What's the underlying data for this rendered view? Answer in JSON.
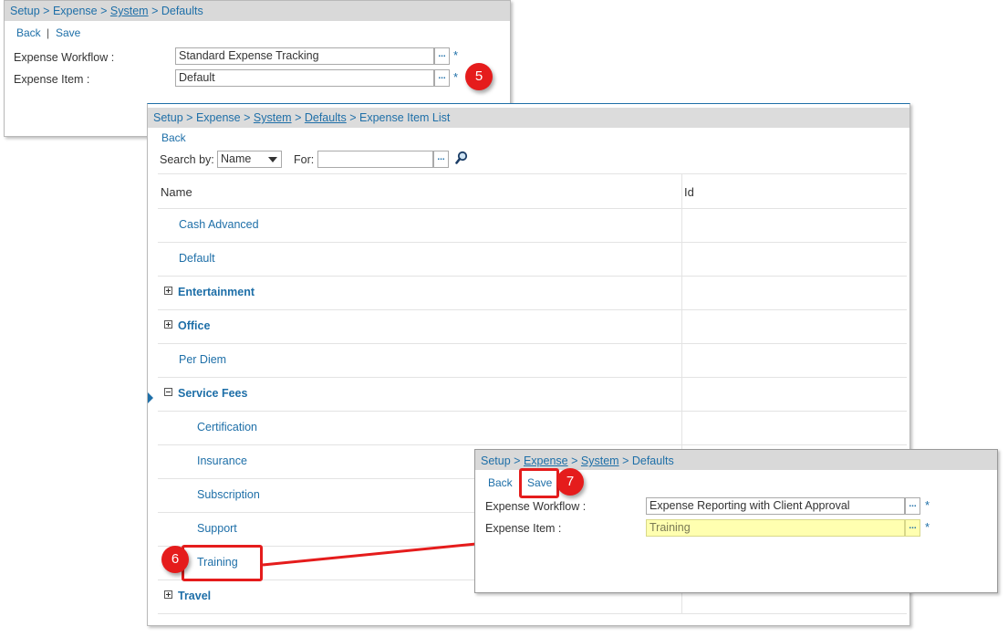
{
  "panel1": {
    "breadcrumb": [
      "Setup",
      "Expense",
      "System",
      "Defaults"
    ],
    "back": "Back",
    "save": "Save",
    "workflow_label": "Expense Workflow :",
    "workflow_value": "Standard Expense Tracking",
    "item_label": "Expense Item :",
    "item_value": "Default",
    "required": "*",
    "dots": "...",
    "callout": "5"
  },
  "panel2": {
    "breadcrumb": [
      "Setup",
      "Expense",
      "System",
      "Defaults",
      "Expense Item List"
    ],
    "back": "Back",
    "search_by_label": "Search by:",
    "search_by_value": "Name",
    "for_label": "For:",
    "dots": "...",
    "columns": [
      "Name",
      "Id"
    ],
    "rows": [
      {
        "name": "Cash Advanced",
        "group": false
      },
      {
        "name": "Default",
        "group": false
      },
      {
        "name": "Entertainment",
        "group": true,
        "expanded": false
      },
      {
        "name": "Office",
        "group": true,
        "expanded": false
      },
      {
        "name": "Per Diem",
        "group": false
      },
      {
        "name": "Service Fees",
        "group": true,
        "expanded": true
      },
      {
        "name": "Certification",
        "group": false,
        "child": true
      },
      {
        "name": "Insurance",
        "group": false,
        "child": true
      },
      {
        "name": "Subscription",
        "group": false,
        "child": true
      },
      {
        "name": "Support",
        "group": false,
        "child": true
      },
      {
        "name": "Training",
        "group": false,
        "child": true
      },
      {
        "name": "Travel",
        "group": true,
        "expanded": false
      }
    ],
    "callout": "6"
  },
  "panel3": {
    "breadcrumb": [
      "Setup",
      "Expense",
      "System",
      "Defaults"
    ],
    "back": "Back",
    "save": "Save",
    "workflow_label": "Expense Workflow :",
    "workflow_value": "Expense Reporting with Client Approval",
    "item_label": "Expense Item :",
    "item_value": "Training",
    "required": "*",
    "dots": "...",
    "callout": "7"
  },
  "colors": {
    "link": "#1e6fa8",
    "highlight": "#e51c1c",
    "selected_field": "#ffffb0"
  }
}
